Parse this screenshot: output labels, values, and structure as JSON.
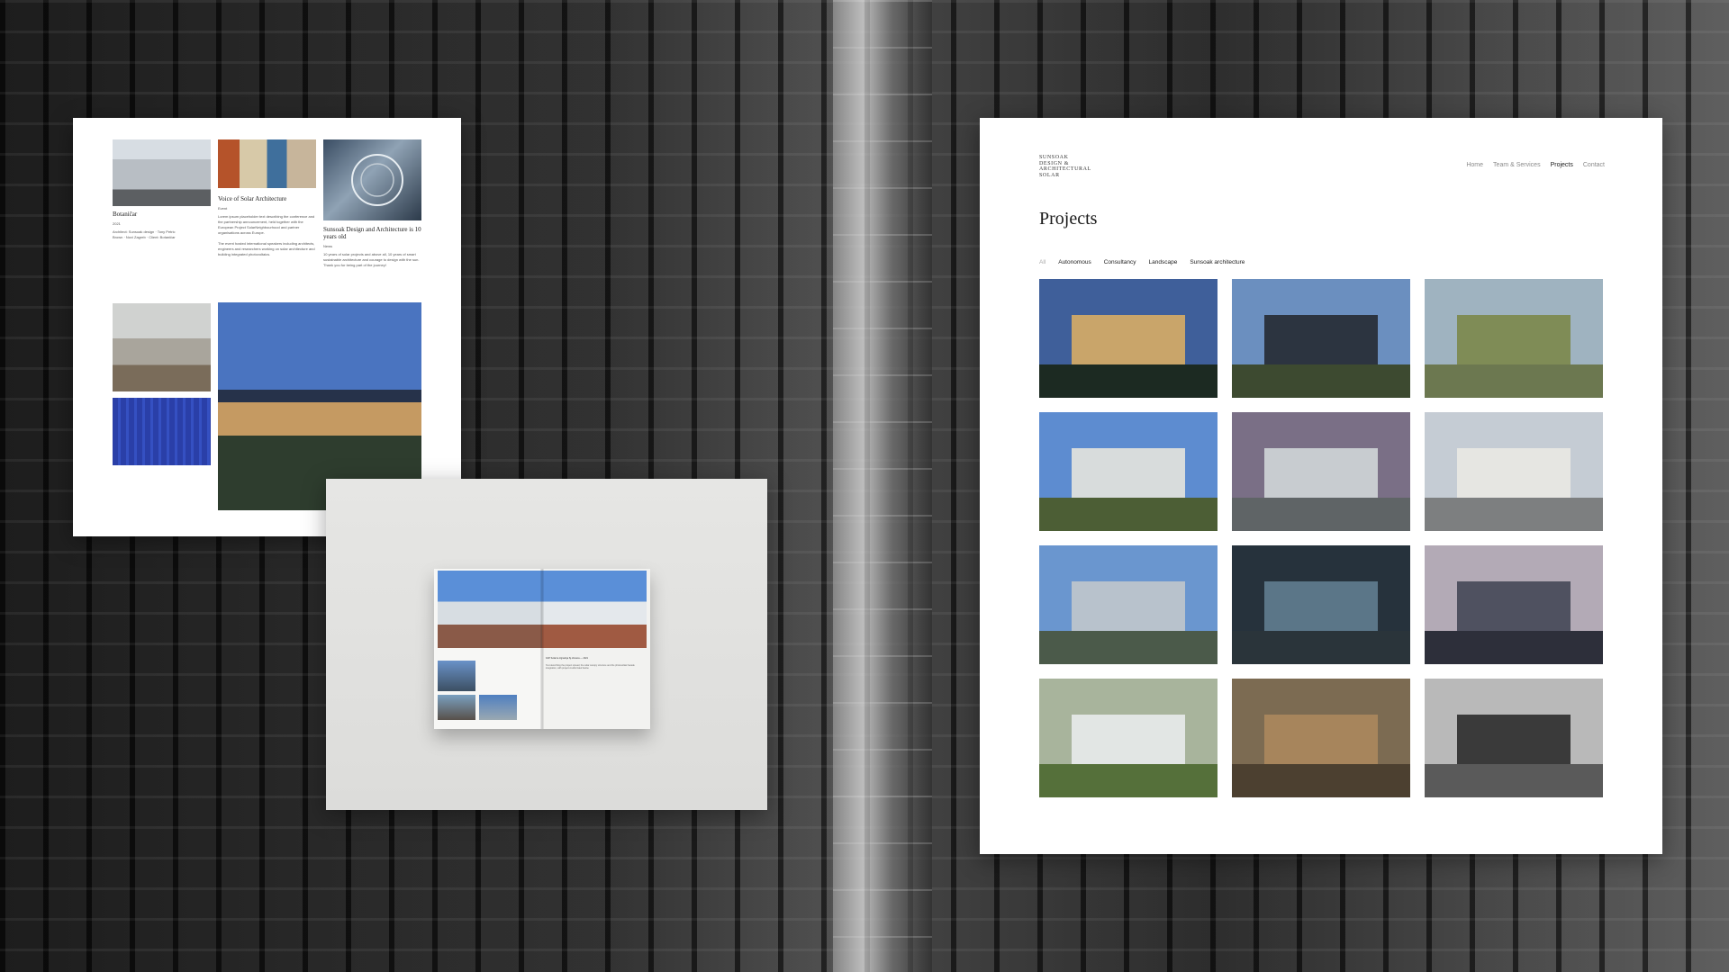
{
  "article_page": {
    "card1": {
      "title": "Botaničar",
      "meta": "2021",
      "details": "Architect: Sunsoak design · Tony Petric Brown · Novi Zagreb · Client: Botaničar"
    },
    "card2": {
      "title": "Voice of Solar Architecture",
      "meta": "Event",
      "body": "Lorem ipsum placeholder text describing the conference and the partnership announcement, held together with the European Project SolarNeighbourhood and partner organisations across Europe.",
      "body2": "The event hosted international speakers including architects, engineers and researchers working on solar architecture and building integrated photovoltaics."
    },
    "card3": {
      "title": "Sunsoak Design and Architecture is 10 years old",
      "meta": "News",
      "body": "10 years of solar projects and above all, 10 years of smart sustainable architecture and courage to design with the sun. Thank you for being part of the journey!"
    }
  },
  "brochure": {
    "caption": "KAP Solarna izgradnja Sj obrasca — 2021",
    "body": "Text describing the project spread, the solar canopy structure and the photovoltaic facade integration, with project credits listed below."
  },
  "site": {
    "logo_lines": [
      "SUNSOAK",
      "DESIGN &",
      "ARCHITECTURAL",
      "SOLAR"
    ],
    "nav": [
      {
        "label": "Home",
        "active": false
      },
      {
        "label": "Team & Services",
        "active": false
      },
      {
        "label": "Projects",
        "active": true
      },
      {
        "label": "Contact",
        "active": false
      }
    ],
    "page_title": "Projects",
    "filters": [
      {
        "label": "All",
        "muted": true
      },
      {
        "label": "Autonomous",
        "muted": false
      },
      {
        "label": "Consultancy",
        "muted": false
      },
      {
        "label": "Landscape",
        "muted": false
      },
      {
        "label": "Sunsoak architecture",
        "muted": false
      }
    ],
    "projects": [
      {
        "name": "project-night-pavilion",
        "sky": "#3f5f9a",
        "ground": "#1c2a22",
        "bldg": "#c9a56a"
      },
      {
        "name": "project-glass-pavilion",
        "sky": "#6b8fbf",
        "ground": "#3d4a30",
        "bldg": "#2c3440"
      },
      {
        "name": "project-solar-roof",
        "sky": "#9fb3c0",
        "ground": "#6c7850",
        "bldg": "#7f8c56"
      },
      {
        "name": "project-canopy-building",
        "sky": "#5d8cd0",
        "ground": "#4c5e35",
        "bldg": "#d8dcdc"
      },
      {
        "name": "project-dome",
        "sky": "#7a6f86",
        "ground": "#5f6466",
        "bldg": "#c8ccd0"
      },
      {
        "name": "project-city-corner",
        "sky": "#c5ccd4",
        "ground": "#7d7f80",
        "bldg": "#e6e6e2"
      },
      {
        "name": "project-towers",
        "sky": "#6a96cf",
        "ground": "#4b5a4a",
        "bldg": "#b8c2cc"
      },
      {
        "name": "project-glass-roof",
        "sky": "#26323c",
        "ground": "#2a343a",
        "bldg": "#5b7688"
      },
      {
        "name": "project-dusk-towers",
        "sky": "#b3aab6",
        "ground": "#2d2f3a",
        "bldg": "#4f5160"
      },
      {
        "name": "project-greenhouse",
        "sky": "#a8b49c",
        "ground": "#55703a",
        "bldg": "#e2e6e4"
      },
      {
        "name": "project-hall-interior",
        "sky": "#7c6b52",
        "ground": "#4c4030",
        "bldg": "#a7855c"
      },
      {
        "name": "project-winter-park",
        "sky": "#b9b9b9",
        "ground": "#5a5a5a",
        "bldg": "#3a3a3a"
      }
    ]
  }
}
